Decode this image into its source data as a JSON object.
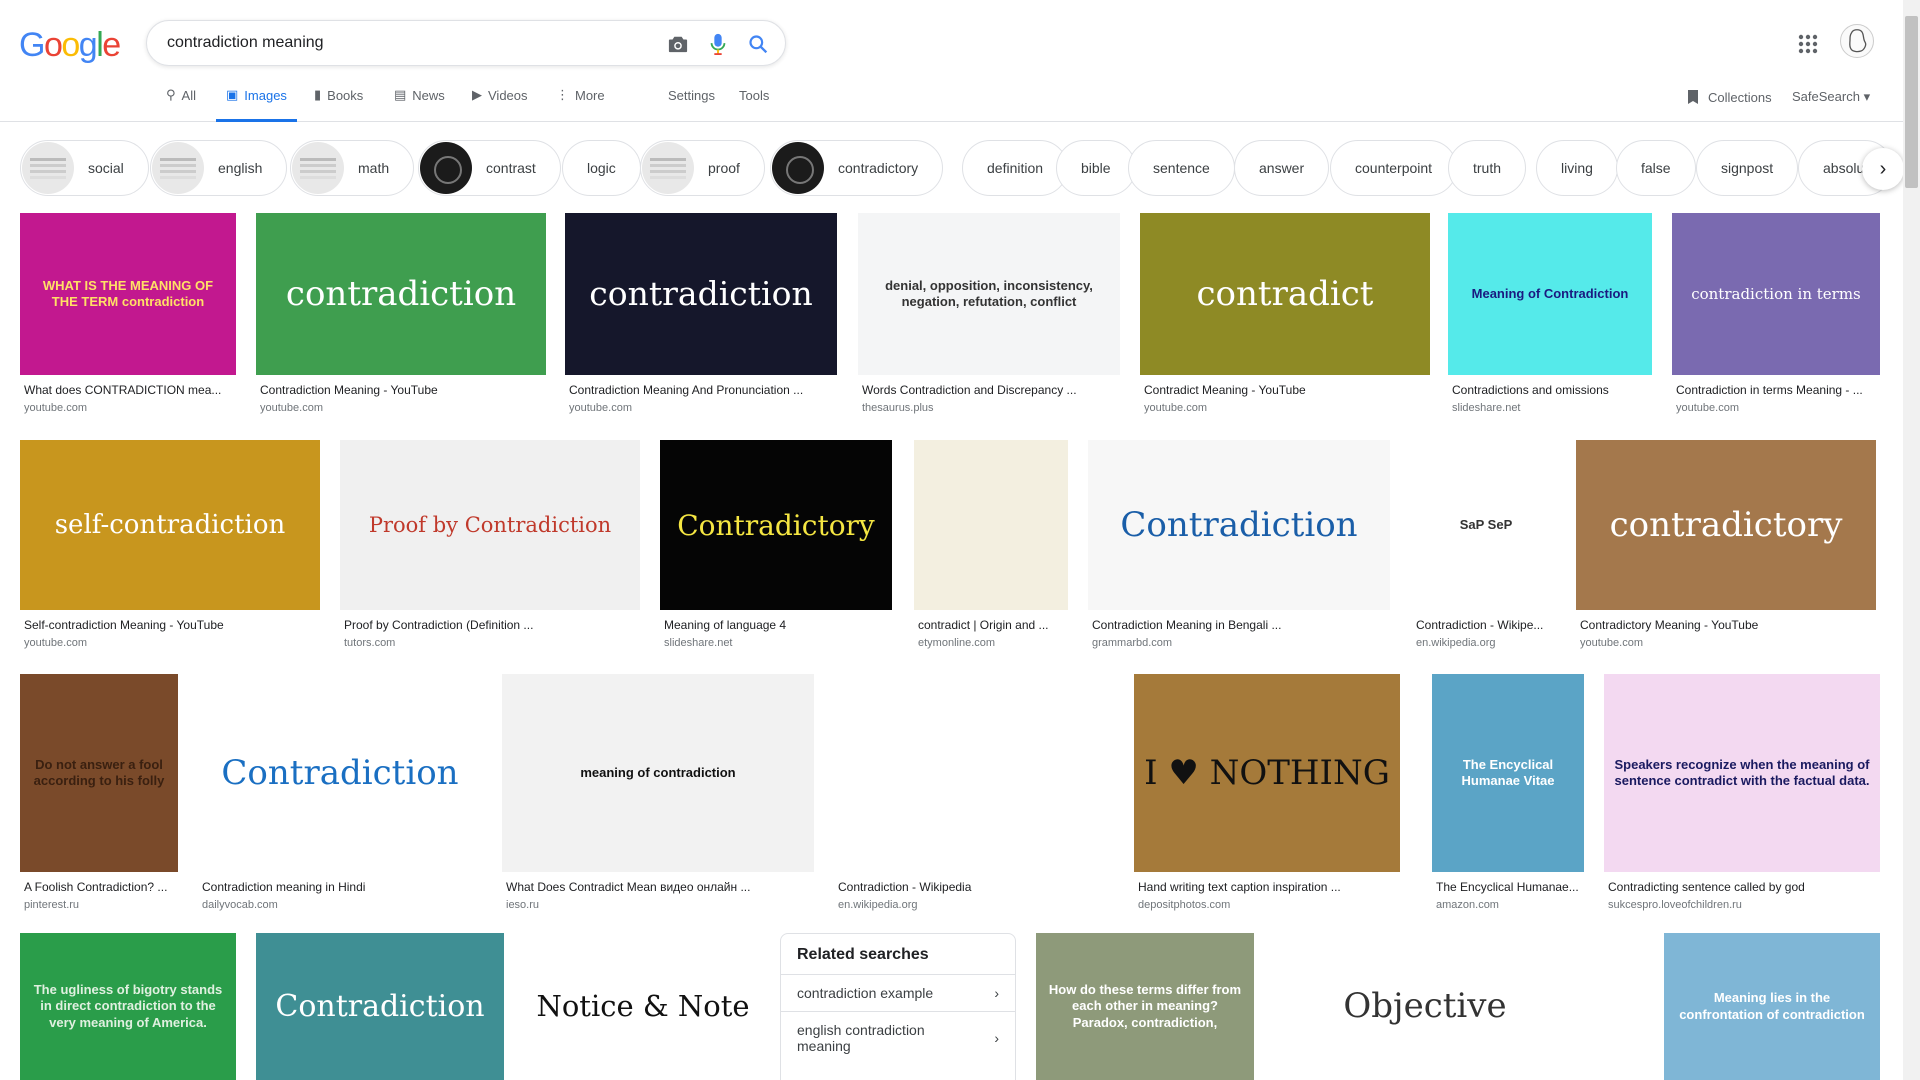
{
  "logo": "Google",
  "search": {
    "value": "contradiction meaning",
    "camera_icon": "camera-icon",
    "mic_icon": "mic-icon",
    "search_icon": "search-icon"
  },
  "tabs": [
    {
      "label": "All",
      "icon": "search-icon"
    },
    {
      "label": "Images",
      "icon": "image-icon",
      "active": true
    },
    {
      "label": "Books",
      "icon": "book-icon"
    },
    {
      "label": "News",
      "icon": "news-icon"
    },
    {
      "label": "Videos",
      "icon": "video-icon"
    },
    {
      "label": "More",
      "icon": "more-icon"
    }
  ],
  "tools": {
    "settings": "Settings",
    "tools": "Tools"
  },
  "collections": "Collections",
  "safesearch": "SafeSearch",
  "chips": [
    "social",
    "english",
    "math",
    "contrast",
    "logic",
    "proof",
    "contradictory",
    "definition",
    "bible",
    "sentence",
    "answer",
    "counterpoint",
    "truth",
    "living",
    "false",
    "signpost",
    "absolut"
  ],
  "results": [
    {
      "title": "What does CONTRADICTION mea...",
      "source": "youtube.com",
      "img_text": "WHAT IS THE MEANING OF THE TERM contradiction",
      "bg": "#c2188f",
      "fg": "#ffe066"
    },
    {
      "title": "Contradiction Meaning - YouTube",
      "source": "youtube.com",
      "img_text": "contradiction",
      "bg": "#3f9e4f",
      "fg": "#ffffff"
    },
    {
      "title": "Contradiction Meaning And Pronunciation ...",
      "source": "youtube.com",
      "img_text": "contradiction",
      "bg": "#15172b",
      "fg": "#ffffff"
    },
    {
      "title": "Words Contradiction and Discrepancy ...",
      "source": "thesaurus.plus",
      "img_text": "denial, opposition, inconsistency, negation, refutation, conflict",
      "bg": "#f4f5f6",
      "fg": "#333333"
    },
    {
      "title": "Contradict Meaning - YouTube",
      "source": "youtube.com",
      "img_text": "contradict",
      "bg": "#8e8a25",
      "fg": "#ffffff"
    },
    {
      "title": "Contradictions and omissions",
      "source": "slideshare.net",
      "img_text": "Meaning of Contradiction",
      "bg": "#55eaea",
      "fg": "#1a1a80"
    },
    {
      "title": "Contradiction in terms Meaning - ...",
      "source": "youtube.com",
      "img_text": "contradiction in terms",
      "bg": "#7a6ab0",
      "fg": "#ffffff"
    },
    {
      "title": "Self-contradiction Meaning - YouTube",
      "source": "youtube.com",
      "img_text": "self-contradiction",
      "bg": "#c8961e",
      "fg": "#ffffff"
    },
    {
      "title": "Proof by Contradiction (Definition ...",
      "source": "tutors.com",
      "img_text": "Proof by Contradiction",
      "bg": "#f0f0f0",
      "fg": "#c0392b"
    },
    {
      "title": "Meaning of language 4",
      "source": "slideshare.net",
      "img_text": "Contradictory",
      "bg": "#050505",
      "fg": "#f5e642"
    },
    {
      "title": "contradict | Origin and ...",
      "source": "etymonline.com",
      "img_text": "",
      "bg": "#f3efe0",
      "fg": "#777777"
    },
    {
      "title": "Contradiction Meaning in Bengali ...",
      "source": "grammarbd.com",
      "img_text": "Contradiction",
      "bg": "#f7f7f7",
      "fg": "#1a5ea8"
    },
    {
      "title": "Contradiction - Wikipe...",
      "source": "en.wikipedia.org",
      "img_text": "SaP  SeP",
      "bg": "#ffffff",
      "fg": "#333333"
    },
    {
      "title": "Contradictory Meaning - YouTube",
      "source": "youtube.com",
      "img_text": "contradictory",
      "bg": "#a4784c",
      "fg": "#ffffff"
    },
    {
      "title": "A Foolish Contradiction? ...",
      "source": "pinterest.ru",
      "img_text": "Do not answer a fool according to his folly",
      "bg": "#7a4a2a",
      "fg": "#3a2010"
    },
    {
      "title": "Contradiction meaning in Hindi",
      "source": "dailyvocab.com",
      "img_text": "Contradiction",
      "bg": "#ffffff",
      "fg": "#1a6fc2"
    },
    {
      "title": "What Does Contradict Mean видео онлайн ...",
      "source": "ieso.ru",
      "img_text": "meaning of contradiction",
      "bg": "#f2f2f2",
      "fg": "#111111"
    },
    {
      "title": "Contradiction - Wikipedia",
      "source": "en.wikipedia.org",
      "img_text": "",
      "bg": "#ffffff",
      "fg": "#333333"
    },
    {
      "title": "Hand writing text caption inspiration ...",
      "source": "depositphotos.com",
      "img_text": "I ♥ NOTHING",
      "bg": "#a57a3a",
      "fg": "#111111"
    },
    {
      "title": "The Encyclical Humanae...",
      "source": "amazon.com",
      "img_text": "The Encyclical Humanae Vitae",
      "bg": "#5ba4c6",
      "fg": "#ffffff"
    },
    {
      "title": "Contradicting sentence called by god",
      "source": "sukcespro.loveofchildren.ru",
      "img_text": "Speakers recognize when the meaning of sentence contradict with the factual data.",
      "bg": "#f3d9f1",
      "fg": "#1a1a60"
    },
    {
      "title": "",
      "source": "",
      "img_text": "The ugliness of bigotry stands in direct contradiction to the very meaning of America.",
      "bg": "#2a9d4a",
      "fg": "#e0f0e0"
    },
    {
      "title": "",
      "source": "",
      "img_text": "Contradiction",
      "bg": "#3f8f94",
      "fg": "#ffffff"
    },
    {
      "title": "",
      "source": "",
      "img_text": "Notice & Note",
      "bg": "#ffffff",
      "fg": "#111111"
    },
    {
      "title": "",
      "source": "",
      "img_text": "How do these terms differ from each other in meaning? Paradox, contradiction,",
      "bg": "#8e9a7a",
      "fg": "#ffffff"
    },
    {
      "title": "",
      "source": "",
      "img_text": "Objective",
      "bg": "#ffffff",
      "fg": "#333333"
    },
    {
      "title": "",
      "source": "",
      "img_text": "Meaning lies in the confrontation of contradiction",
      "bg": "#7fb6d6",
      "fg": "#ffffff"
    }
  ],
  "related": {
    "heading": "Related searches",
    "items": [
      "contradiction example",
      "english contradiction meaning"
    ]
  }
}
